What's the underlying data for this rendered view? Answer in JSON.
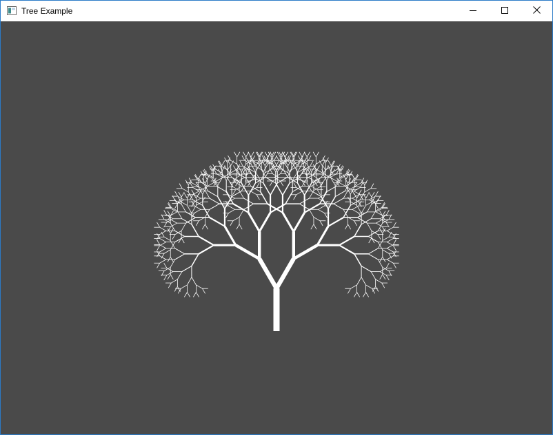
{
  "window": {
    "title": "Tree Example",
    "buttons": {
      "minimize": "minimize-icon",
      "maximize": "maximize-icon",
      "close": "close-icon"
    }
  },
  "canvas": {
    "background_color": "#4a4a4a",
    "branch_color": "#ffffff",
    "tree": {
      "recursion_depth": 10,
      "branch_angle_deg": 30,
      "length_ratio": 0.8,
      "thickness_ratio": 0.7
    }
  }
}
